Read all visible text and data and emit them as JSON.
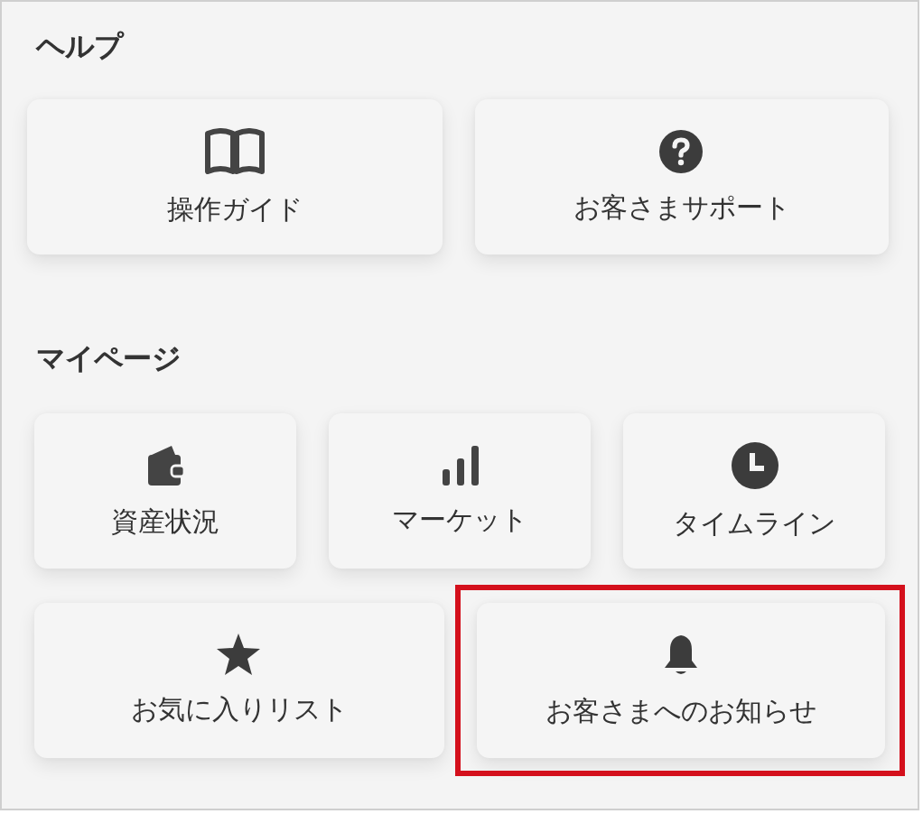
{
  "sections": [
    {
      "title": "ヘルプ",
      "items": [
        {
          "label": "操作ガイド",
          "highlighted": false
        },
        {
          "label": "お客さまサポート",
          "highlighted": false
        }
      ]
    },
    {
      "title": "マイページ",
      "items": [
        {
          "label": "資産状況",
          "highlighted": false
        },
        {
          "label": "マーケット",
          "highlighted": false
        },
        {
          "label": "タイムライン",
          "highlighted": false
        },
        {
          "label": "お気に入りリスト",
          "highlighted": false
        },
        {
          "label": "お客さまへのお知らせ",
          "highlighted": true
        }
      ]
    }
  ]
}
